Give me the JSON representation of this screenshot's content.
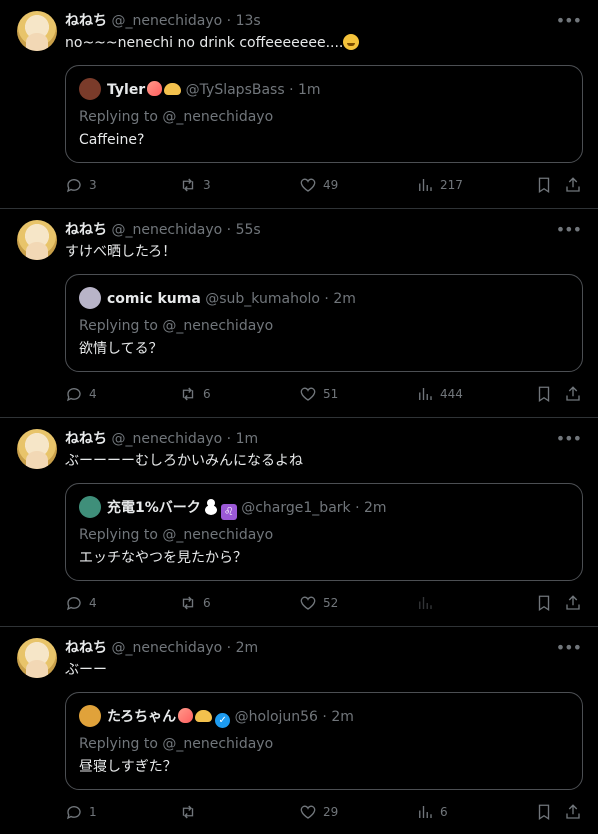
{
  "tweets": [
    {
      "name": "ねねち",
      "handle": "@_nenechidayo",
      "time": "13s",
      "text": "no~~~nenechi no drink coffeeeeeee....",
      "emoji": "face-holding-back-tears",
      "quote": {
        "name": "Tyler",
        "handle": "@TySlapsBass",
        "time": "1m",
        "badges": [
          "peach",
          "bun"
        ],
        "reply_prefix": "Replying to",
        "reply_to": "@_nenechidayo",
        "text": "Caffeine?",
        "avatar_color": "#7a3b2a"
      },
      "counts": {
        "replies": "3",
        "reposts": "3",
        "likes": "49",
        "views": "217"
      }
    },
    {
      "name": "ねねち",
      "handle": "@_nenechidayo",
      "time": "55s",
      "text": "すけべ晒したろ！",
      "quote": {
        "name": "comic kuma",
        "handle": "@sub_kumaholo",
        "time": "2m",
        "badges": [],
        "reply_prefix": "Replying to",
        "reply_to": "@_nenechidayo",
        "text": "欲情してる？",
        "avatar_color": "#b8b4c8"
      },
      "counts": {
        "replies": "4",
        "reposts": "6",
        "likes": "51",
        "views": "444"
      }
    },
    {
      "name": "ねねち",
      "handle": "@_nenechidayo",
      "time": "1m",
      "text": "ぶーーーーむしろかいみんになるよね",
      "quote": {
        "name": "充電1%バーク",
        "handle": "@charge1_bark",
        "time": "2m",
        "badges": [
          "snowman",
          "leo"
        ],
        "reply_prefix": "Replying to",
        "reply_to": "@_nenechidayo",
        "text": "エッチなやつを見たから？",
        "avatar_color": "#3f8f7a"
      },
      "counts": {
        "replies": "4",
        "reposts": "6",
        "likes": "52",
        "views": ""
      }
    },
    {
      "name": "ねねち",
      "handle": "@_nenechidayo",
      "time": "2m",
      "text": "ぶーー",
      "quote": {
        "name": "たろちゃん",
        "handle": "@holojun56",
        "time": "2m",
        "badges": [
          "peach",
          "bun",
          "verified"
        ],
        "reply_prefix": "Replying to",
        "reply_to": "@_nenechidayo",
        "text": "昼寝しすぎた？",
        "avatar_color": "#e0a23a"
      },
      "counts": {
        "replies": "1",
        "reposts": "",
        "likes": "29",
        "views": "6"
      }
    }
  ],
  "ui": {
    "dot": "·",
    "more": "•••"
  },
  "colors": {
    "background": "#000000",
    "text": "#e7e9ea",
    "muted": "#71767b",
    "border": "#2f3336",
    "verified": "#1d9bf0"
  }
}
